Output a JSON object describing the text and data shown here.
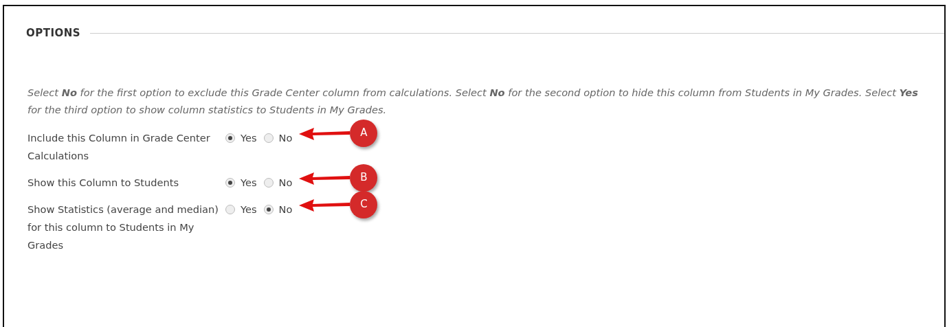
{
  "section": {
    "title": "OPTIONS"
  },
  "instructions": "Select **No** for the first option to exclude this Grade Center column from calculations. Select **No** for the second option to hide this column from Students in My Grades. Select **Yes** for the third option to show column statistics to Students in My Grades.",
  "options": [
    {
      "label": "Include this Column in Grade Center Calculations",
      "choices": [
        {
          "label": "Yes",
          "selected": true
        },
        {
          "label": "No",
          "selected": false
        }
      ],
      "callout": "A"
    },
    {
      "label": "Show this Column to Students",
      "choices": [
        {
          "label": "Yes",
          "selected": true
        },
        {
          "label": "No",
          "selected": false
        }
      ],
      "callout": "B"
    },
    {
      "label": "Show Statistics (average and median) for this column to Students in My Grades",
      "choices": [
        {
          "label": "Yes",
          "selected": false
        },
        {
          "label": "No",
          "selected": true
        }
      ],
      "callout": "C"
    }
  ]
}
